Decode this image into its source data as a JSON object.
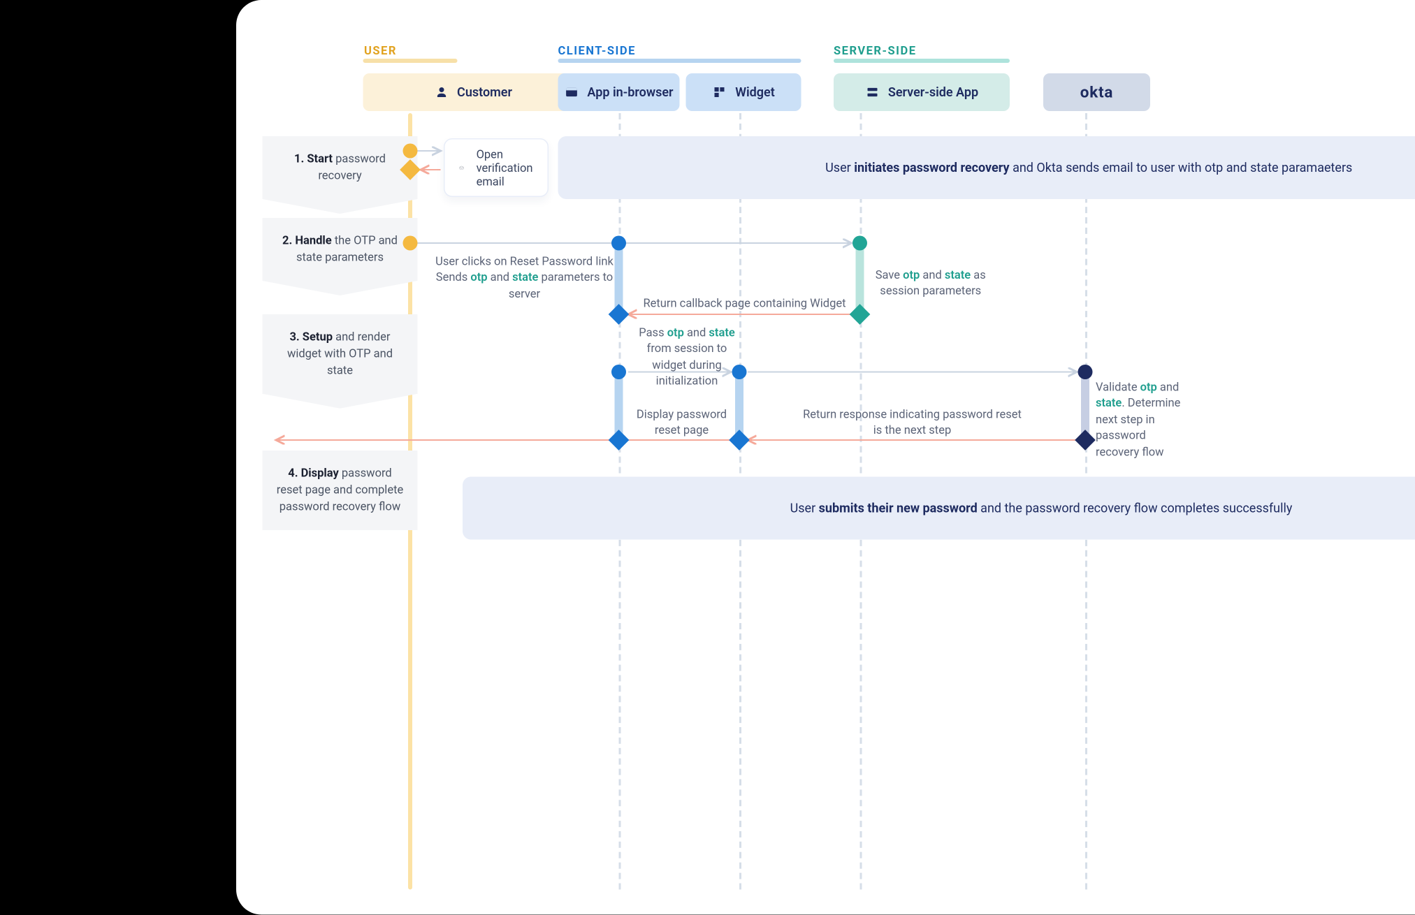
{
  "lanes": {
    "user": "USER",
    "client": "CLIENT-SIDE",
    "server": "SERVER-SIDE"
  },
  "actors": {
    "customer": "Customer",
    "app": "App in-browser",
    "widget": "Widget",
    "srv": "Server-side App",
    "okta": "okta"
  },
  "steps": [
    {
      "num": "1.",
      "bold": "Start",
      "rest": " password recovery"
    },
    {
      "num": "2.",
      "bold": "Handle",
      "rest": " the OTP and state parameters"
    },
    {
      "num": "3.",
      "bold": "Setup",
      "rest": " and render widget with OTP and state"
    },
    {
      "num": "4.",
      "bold": "Display",
      "rest": " password reset page and complete password recovery flow"
    }
  ],
  "notes": {
    "openEmail": "Open verification email",
    "clickReset1": "User clicks on Reset Password link",
    "clickReset2_a": "Sends ",
    "clickReset2_b": " and ",
    "clickReset2_c": " parameters to server",
    "saveSession_a": "Save ",
    "saveSession_b": " and ",
    "saveSession_c": " as session parameters",
    "returnCallback": "Return callback page containing Widget",
    "passInit_a": "Pass ",
    "passInit_b": " and ",
    "passInit_c": " from session to widget during initialization",
    "displayReset": "Display password reset page",
    "returnResponse": "Return response indicating password reset is the next step",
    "validate_a": "Validate ",
    "validate_b": " and ",
    "validate_c": ". Determine next step in password recovery flow",
    "kw_otp": "otp",
    "kw_state": "state"
  },
  "banners": {
    "b1_a": "User ",
    "b1_b": "initiates password recovery",
    "b1_c": " and Okta sends email to user with otp and state paramaeters",
    "b2_a": "User ",
    "b2_b": "submits their new password",
    "b2_c": " and the password recovery flow completes successfully"
  }
}
